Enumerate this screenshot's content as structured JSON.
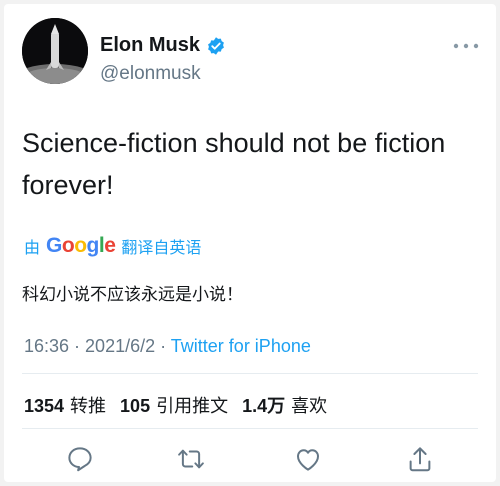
{
  "author": {
    "name": "Elon Musk",
    "handle": "@elonmusk"
  },
  "tweet": {
    "text": "Science-fiction should not be fiction forever!"
  },
  "translation": {
    "by_label": "由",
    "provider": "Google",
    "action_label": "翻译自英语",
    "translated_text": "科幻小说不应该永远是小说！"
  },
  "meta": {
    "time": "16:36",
    "separator": " · ",
    "date": "2021/6/2",
    "source": "Twitter for iPhone"
  },
  "stats": {
    "retweets_count": "1354",
    "retweets_label": "转推",
    "quote_count": "105",
    "quote_label": "引用推文",
    "likes_count": "1.4万",
    "likes_label": "喜欢"
  },
  "colors": {
    "accent": "#1da1f2",
    "muted": "#657786",
    "text": "#14171a"
  },
  "icons": {
    "more": "more-horizontal-icon",
    "verified": "verified-badge-icon",
    "reply": "reply-icon",
    "retweet": "retweet-icon",
    "like": "like-icon",
    "share": "share-icon"
  }
}
